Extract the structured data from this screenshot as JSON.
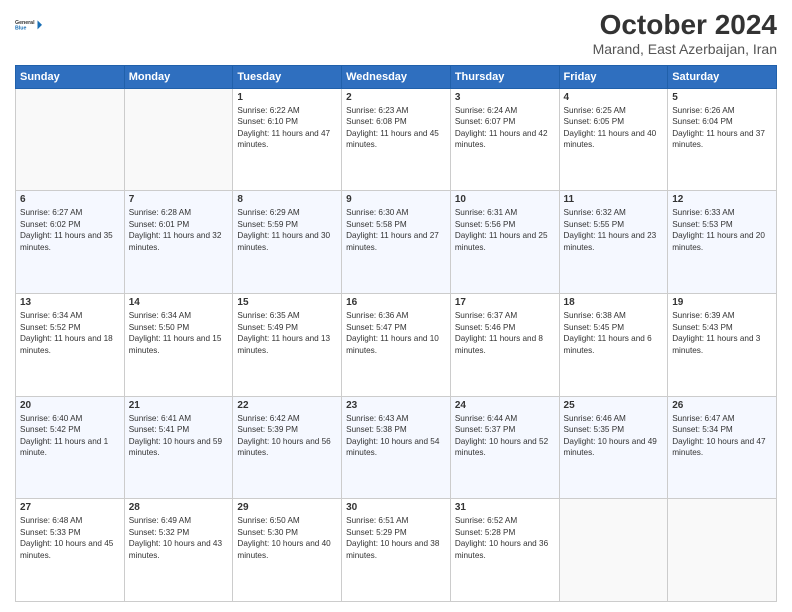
{
  "header": {
    "logo_line1": "General",
    "logo_line2": "Blue",
    "title": "October 2024",
    "subtitle": "Marand, East Azerbaijan, Iran"
  },
  "days_of_week": [
    "Sunday",
    "Monday",
    "Tuesday",
    "Wednesday",
    "Thursday",
    "Friday",
    "Saturday"
  ],
  "weeks": [
    [
      {
        "day": "",
        "info": ""
      },
      {
        "day": "",
        "info": ""
      },
      {
        "day": "1",
        "info": "Sunrise: 6:22 AM\nSunset: 6:10 PM\nDaylight: 11 hours and 47 minutes."
      },
      {
        "day": "2",
        "info": "Sunrise: 6:23 AM\nSunset: 6:08 PM\nDaylight: 11 hours and 45 minutes."
      },
      {
        "day": "3",
        "info": "Sunrise: 6:24 AM\nSunset: 6:07 PM\nDaylight: 11 hours and 42 minutes."
      },
      {
        "day": "4",
        "info": "Sunrise: 6:25 AM\nSunset: 6:05 PM\nDaylight: 11 hours and 40 minutes."
      },
      {
        "day": "5",
        "info": "Sunrise: 6:26 AM\nSunset: 6:04 PM\nDaylight: 11 hours and 37 minutes."
      }
    ],
    [
      {
        "day": "6",
        "info": "Sunrise: 6:27 AM\nSunset: 6:02 PM\nDaylight: 11 hours and 35 minutes."
      },
      {
        "day": "7",
        "info": "Sunrise: 6:28 AM\nSunset: 6:01 PM\nDaylight: 11 hours and 32 minutes."
      },
      {
        "day": "8",
        "info": "Sunrise: 6:29 AM\nSunset: 5:59 PM\nDaylight: 11 hours and 30 minutes."
      },
      {
        "day": "9",
        "info": "Sunrise: 6:30 AM\nSunset: 5:58 PM\nDaylight: 11 hours and 27 minutes."
      },
      {
        "day": "10",
        "info": "Sunrise: 6:31 AM\nSunset: 5:56 PM\nDaylight: 11 hours and 25 minutes."
      },
      {
        "day": "11",
        "info": "Sunrise: 6:32 AM\nSunset: 5:55 PM\nDaylight: 11 hours and 23 minutes."
      },
      {
        "day": "12",
        "info": "Sunrise: 6:33 AM\nSunset: 5:53 PM\nDaylight: 11 hours and 20 minutes."
      }
    ],
    [
      {
        "day": "13",
        "info": "Sunrise: 6:34 AM\nSunset: 5:52 PM\nDaylight: 11 hours and 18 minutes."
      },
      {
        "day": "14",
        "info": "Sunrise: 6:34 AM\nSunset: 5:50 PM\nDaylight: 11 hours and 15 minutes."
      },
      {
        "day": "15",
        "info": "Sunrise: 6:35 AM\nSunset: 5:49 PM\nDaylight: 11 hours and 13 minutes."
      },
      {
        "day": "16",
        "info": "Sunrise: 6:36 AM\nSunset: 5:47 PM\nDaylight: 11 hours and 10 minutes."
      },
      {
        "day": "17",
        "info": "Sunrise: 6:37 AM\nSunset: 5:46 PM\nDaylight: 11 hours and 8 minutes."
      },
      {
        "day": "18",
        "info": "Sunrise: 6:38 AM\nSunset: 5:45 PM\nDaylight: 11 hours and 6 minutes."
      },
      {
        "day": "19",
        "info": "Sunrise: 6:39 AM\nSunset: 5:43 PM\nDaylight: 11 hours and 3 minutes."
      }
    ],
    [
      {
        "day": "20",
        "info": "Sunrise: 6:40 AM\nSunset: 5:42 PM\nDaylight: 11 hours and 1 minute."
      },
      {
        "day": "21",
        "info": "Sunrise: 6:41 AM\nSunset: 5:41 PM\nDaylight: 10 hours and 59 minutes."
      },
      {
        "day": "22",
        "info": "Sunrise: 6:42 AM\nSunset: 5:39 PM\nDaylight: 10 hours and 56 minutes."
      },
      {
        "day": "23",
        "info": "Sunrise: 6:43 AM\nSunset: 5:38 PM\nDaylight: 10 hours and 54 minutes."
      },
      {
        "day": "24",
        "info": "Sunrise: 6:44 AM\nSunset: 5:37 PM\nDaylight: 10 hours and 52 minutes."
      },
      {
        "day": "25",
        "info": "Sunrise: 6:46 AM\nSunset: 5:35 PM\nDaylight: 10 hours and 49 minutes."
      },
      {
        "day": "26",
        "info": "Sunrise: 6:47 AM\nSunset: 5:34 PM\nDaylight: 10 hours and 47 minutes."
      }
    ],
    [
      {
        "day": "27",
        "info": "Sunrise: 6:48 AM\nSunset: 5:33 PM\nDaylight: 10 hours and 45 minutes."
      },
      {
        "day": "28",
        "info": "Sunrise: 6:49 AM\nSunset: 5:32 PM\nDaylight: 10 hours and 43 minutes."
      },
      {
        "day": "29",
        "info": "Sunrise: 6:50 AM\nSunset: 5:30 PM\nDaylight: 10 hours and 40 minutes."
      },
      {
        "day": "30",
        "info": "Sunrise: 6:51 AM\nSunset: 5:29 PM\nDaylight: 10 hours and 38 minutes."
      },
      {
        "day": "31",
        "info": "Sunrise: 6:52 AM\nSunset: 5:28 PM\nDaylight: 10 hours and 36 minutes."
      },
      {
        "day": "",
        "info": ""
      },
      {
        "day": "",
        "info": ""
      }
    ]
  ]
}
